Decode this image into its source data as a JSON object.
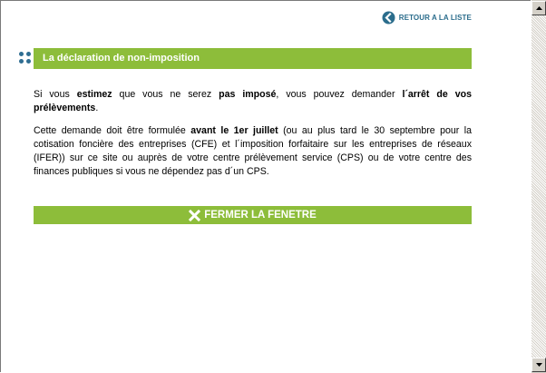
{
  "header": {
    "back_link_label": "RETOUR A LA LISTE"
  },
  "section": {
    "title": "La déclaration de non-imposition"
  },
  "paragraph1": {
    "t1": "Si vous ",
    "b1": "estimez",
    "t2": " que vous ne serez ",
    "b2": "pas imposé",
    "t3": ", vous pouvez demander ",
    "b3": "l´arrêt de vos prélèvements",
    "t4": "."
  },
  "paragraph2": {
    "t1": "Cette demande doit être formulée ",
    "b1": "avant le 1er juillet",
    "t2": " (ou au plus tard le 30 septembre pour la cotisation foncière des entreprises (CFE) et l´imposition forfaitaire sur les entreprises de réseaux (IFER)) sur ce site ou auprès de votre centre prélèvement service (CPS) ou de votre centre des finances publiques si vous ne dépendez pas d´un CPS."
  },
  "footer": {
    "close_label": "FERMER LA FENETRE"
  },
  "colors": {
    "accent_green": "#8dbd3a",
    "link_blue": "#2b6d8c"
  },
  "icons": {
    "back": "back-arrow-circle-icon",
    "bullet": "four-dots-icon",
    "close": "close-x-icon",
    "scroll_up": "scroll-up-arrow-icon",
    "scroll_down": "scroll-down-arrow-icon"
  }
}
